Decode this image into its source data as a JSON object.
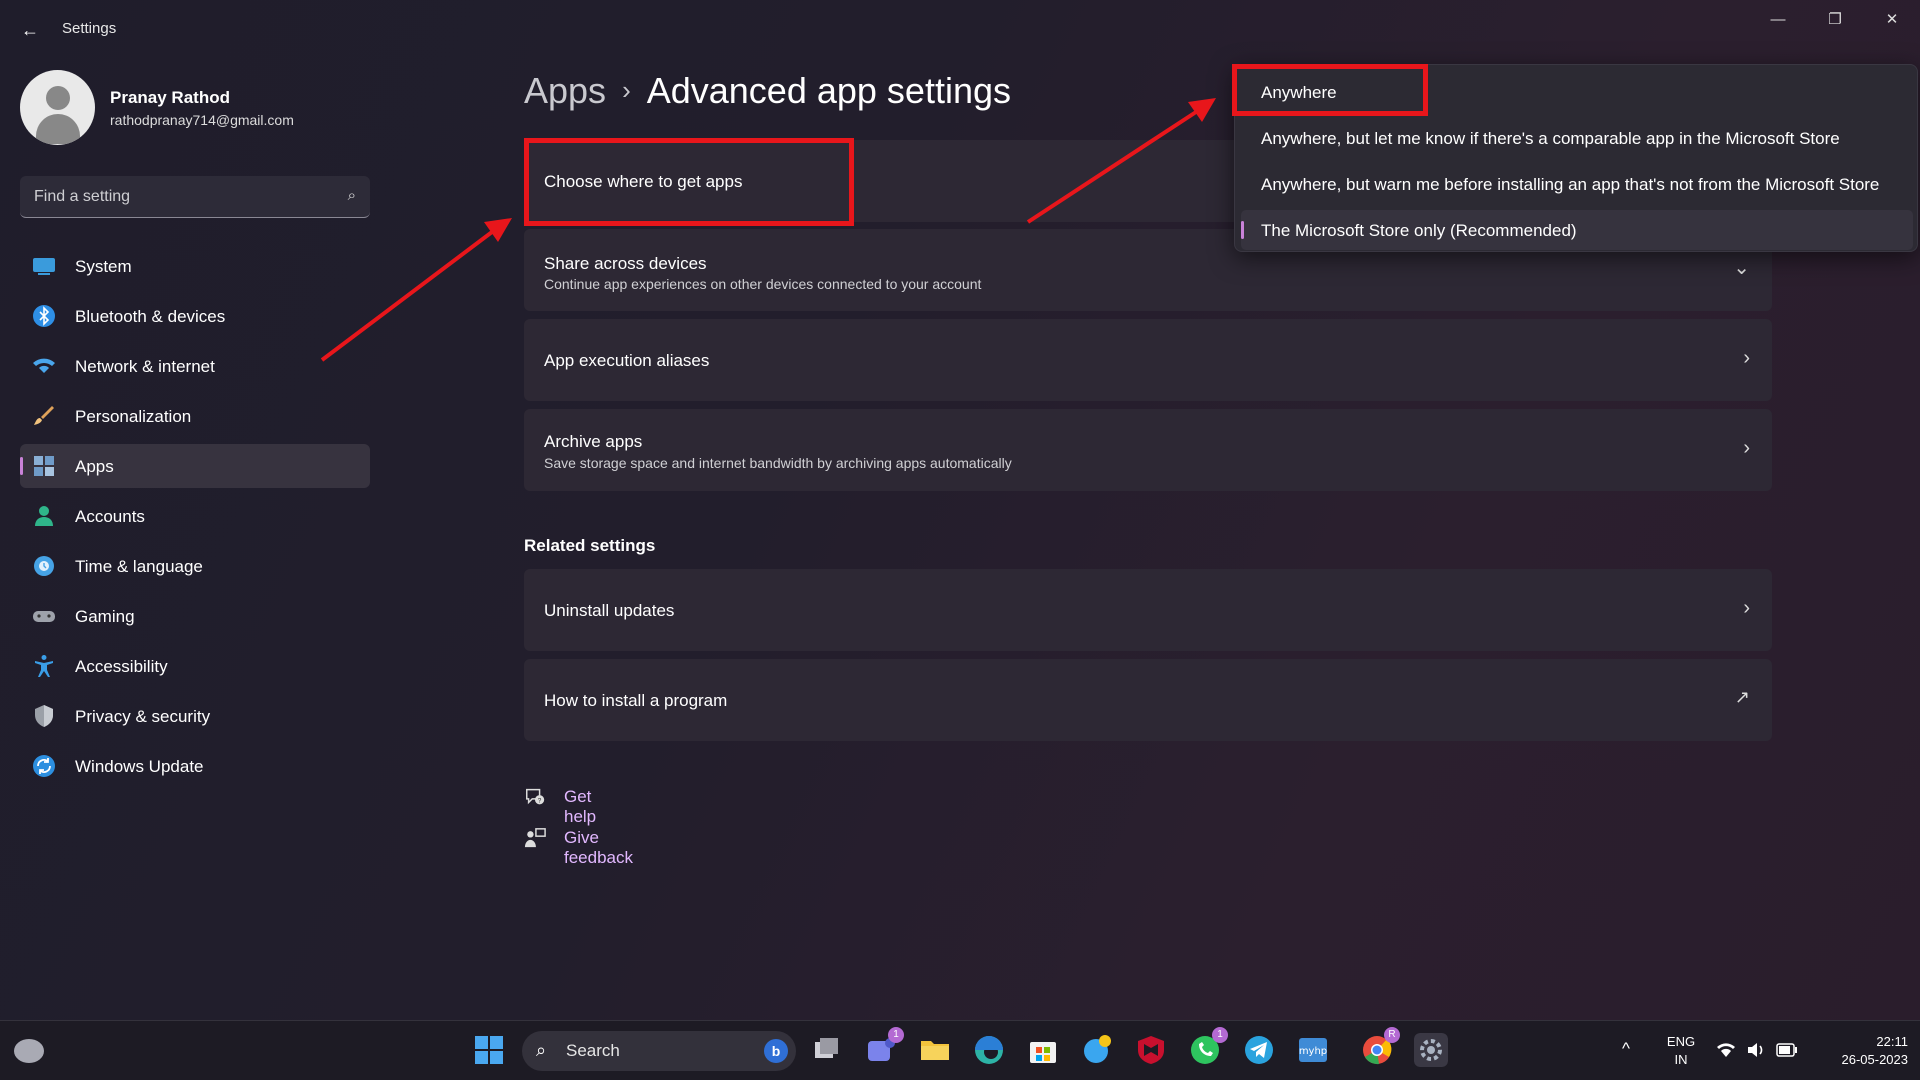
{
  "window": {
    "back_glyph": "←",
    "app_title": "Settings",
    "min_glyph": "—",
    "max_glyph": "❐",
    "close_glyph": "✕"
  },
  "profile": {
    "name": "Pranay Rathod",
    "email": "rathodpranay714@gmail.com"
  },
  "search": {
    "placeholder": "Find a setting",
    "icon": "search-icon"
  },
  "sidebar": {
    "items": [
      {
        "label": "System",
        "icon": "system-icon",
        "color": "#3a9bdc"
      },
      {
        "label": "Bluetooth & devices",
        "icon": "bluetooth-icon",
        "color": "#2e8fe6"
      },
      {
        "label": "Network & internet",
        "icon": "wifi-icon",
        "color": "#4aa6ec"
      },
      {
        "label": "Personalization",
        "icon": "brush-icon",
        "color": "#e0a25a"
      },
      {
        "label": "Apps",
        "icon": "apps-icon",
        "color": "#8ab0d6",
        "active": true
      },
      {
        "label": "Accounts",
        "icon": "accounts-icon",
        "color": "#2fb58a"
      },
      {
        "label": "Time & language",
        "icon": "globe-icon",
        "color": "#46a3e6"
      },
      {
        "label": "Gaming",
        "icon": "gamepad-icon",
        "color": "#9ea2ab"
      },
      {
        "label": "Accessibility",
        "icon": "accessibility-icon",
        "color": "#3a9ee8"
      },
      {
        "label": "Privacy & security",
        "icon": "shield-icon",
        "color": "#9ba0a8"
      },
      {
        "label": "Windows Update",
        "icon": "update-icon",
        "color": "#2c8fe0"
      }
    ]
  },
  "main": {
    "breadcrumb_root": "Apps",
    "breadcrumb_sep": "›",
    "page_title": "Advanced app settings",
    "cards": [
      {
        "title": "Choose where to get apps",
        "subtitle": ""
      },
      {
        "title": "Share across devices",
        "subtitle": "Continue app experiences on other devices connected to your account",
        "chevron": "⌄"
      },
      {
        "title": "App execution aliases",
        "subtitle": "",
        "chevron": "›"
      },
      {
        "title": "Archive apps",
        "subtitle": "Save storage space and internet bandwidth by archiving apps automatically",
        "chevron": "›"
      }
    ],
    "related_heading": "Related settings",
    "related": [
      {
        "title": "Uninstall updates",
        "chevron": "›"
      },
      {
        "title": "How to install a program",
        "chevron": "↗"
      }
    ],
    "help": [
      {
        "label": "Get help",
        "icon": "help-icon"
      },
      {
        "label": "Give feedback",
        "icon": "feedback-icon"
      }
    ]
  },
  "dropdown": {
    "options": [
      "Anywhere",
      "Anywhere, but let me know if there's a comparable app in the Microsoft Store",
      "Anywhere, but warn me before installing an app that's not from the Microsoft Store",
      "The Microsoft Store only (Recommended)"
    ],
    "selected_index": 3
  },
  "annotations": {
    "highlight_color": "#e8161b"
  },
  "taskbar": {
    "search_label": "Search",
    "bing_letter": "b",
    "apps": [
      {
        "icon": "start-icon",
        "color": "#4aa8f0"
      },
      {
        "icon": "task-view-icon",
        "color": "#cfcfd6"
      },
      {
        "icon": "teams-icon",
        "color": "#7b83eb",
        "badge": "1"
      },
      {
        "icon": "file-explorer-icon",
        "color": "#f3c33c"
      },
      {
        "icon": "edge-icon",
        "color": "#2db3a6"
      },
      {
        "icon": "store-icon",
        "color": "#f2f2f2"
      },
      {
        "icon": "tips-icon",
        "color": "#3aa6ef"
      },
      {
        "icon": "mcafee-icon",
        "color": "#c8102e"
      },
      {
        "icon": "whatsapp-icon",
        "color": "#2ec45f",
        "badge": "1"
      },
      {
        "icon": "telegram-icon",
        "color": "#2aa3de"
      },
      {
        "icon": "myhp-icon",
        "color": "#3f8bd6"
      },
      {
        "icon": "chrome-icon",
        "color": "#e84c3d"
      },
      {
        "icon": "settings-icon",
        "color": "#a9b3c2"
      }
    ],
    "chrome_badge": "R",
    "chevron_up": "^",
    "lang_line1": "ENG",
    "lang_line2": "IN",
    "time": "22:11",
    "date": "26-05-2023"
  }
}
